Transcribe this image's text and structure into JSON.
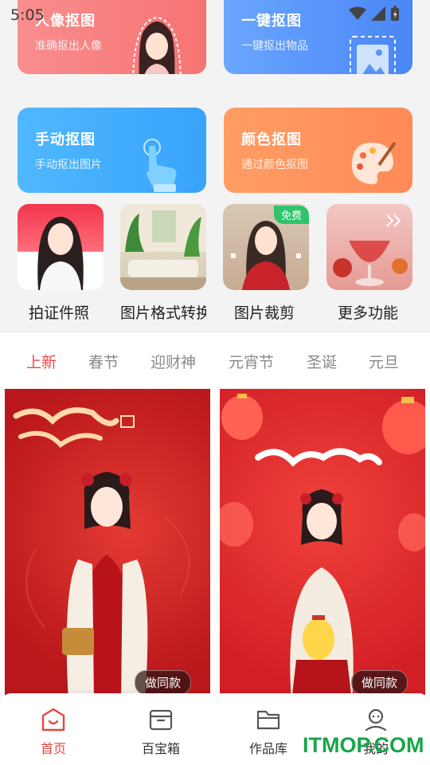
{
  "status": {
    "time": "5:05"
  },
  "cards": [
    {
      "title": "人像抠图",
      "subtitle": "准确抠出人像",
      "color": "#f77373"
    },
    {
      "title": "一键抠图",
      "subtitle": "一键抠出物品",
      "color": "#4a86f5"
    },
    {
      "title": "手动抠图",
      "subtitle": "手动抠出图片",
      "color": "#38a3fb"
    },
    {
      "title": "颜色抠图",
      "subtitle": "通过颜色抠图",
      "color": "#ff8a58"
    }
  ],
  "features": [
    {
      "label": "拍证件照"
    },
    {
      "label": "图片格式转换"
    },
    {
      "label": "图片裁剪",
      "badge": "免费"
    },
    {
      "label": "更多功能"
    }
  ],
  "tabs": [
    "上新",
    "春节",
    "迎财神",
    "元宵节",
    "圣诞",
    "元旦"
  ],
  "active_tab": "上新",
  "posters": [
    {
      "button": "做同款"
    },
    {
      "button": "做同款"
    }
  ],
  "nav": [
    {
      "label": "首页",
      "icon": "home-icon",
      "active": true
    },
    {
      "label": "百宝箱",
      "icon": "toolbox-icon"
    },
    {
      "label": "作品库",
      "icon": "folder-icon"
    },
    {
      "label": "我的",
      "icon": "profile-icon"
    }
  ],
  "watermark": "ITMOP.COM",
  "colors": {
    "accent": "#ee4a4a",
    "badge": "#2fc46a",
    "watermark": "#19a548"
  }
}
